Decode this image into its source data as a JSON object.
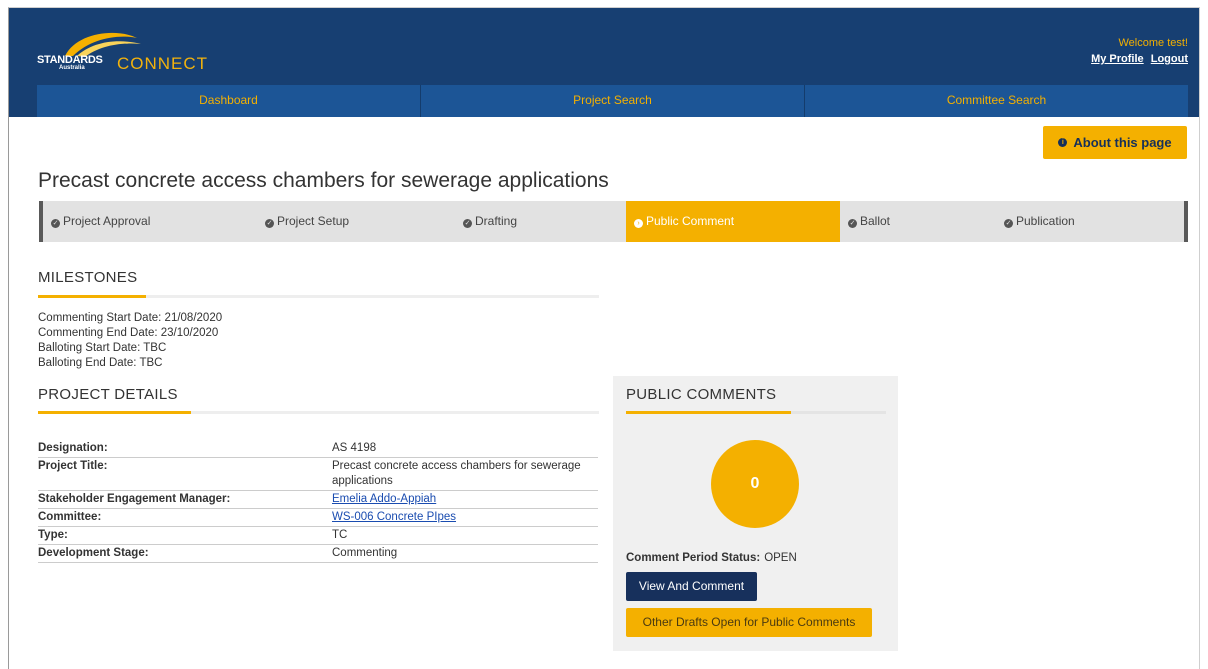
{
  "header": {
    "logo_text_standards": "STANDARDS",
    "logo_text_australia": "Australia",
    "logo_text_connect": "CONNECT",
    "welcome": "Welcome test!",
    "my_profile": "My Profile",
    "logout": "Logout"
  },
  "nav": {
    "items": [
      {
        "label": "Dashboard"
      },
      {
        "label": "Project Search"
      },
      {
        "label": "Committee Search"
      }
    ]
  },
  "about_button": {
    "label": "About this page",
    "icon": "info-icon"
  },
  "page_title": "Precast concrete access chambers for sewerage applications",
  "stages": [
    {
      "label": "Project Approval",
      "icon": "check-circle-icon",
      "status": "complete"
    },
    {
      "label": "Project Setup",
      "icon": "check-circle-icon",
      "status": "complete"
    },
    {
      "label": "Drafting",
      "icon": "check-circle-icon",
      "status": "complete"
    },
    {
      "label": "Public Comment",
      "icon": "arrow-circle-icon",
      "status": "current"
    },
    {
      "label": "Ballot",
      "icon": "check-circle-icon",
      "status": "pending"
    },
    {
      "label": "Publication",
      "icon": "check-circle-icon",
      "status": "pending"
    }
  ],
  "milestones": {
    "title": "MILESTONES",
    "items": [
      "Commenting Start Date: 21/08/2020",
      "Commenting End Date: 23/10/2020",
      "Balloting Start Date: TBC",
      "Balloting End Date: TBC"
    ]
  },
  "project_details": {
    "title": "PROJECT DETAILS",
    "rows": [
      {
        "label": "Designation",
        "value": "AS 4198"
      },
      {
        "label": "Project Title",
        "value": "Precast concrete access chambers for sewerage applications"
      },
      {
        "label": "Stakeholder Engagement Manager",
        "value": "Emelia Addo-Appiah"
      },
      {
        "label": "Committee",
        "value": "WS-006 Concrete PIpes"
      },
      {
        "label": "Type",
        "value": "TC"
      },
      {
        "label": "Development Stage",
        "value": "Commenting"
      }
    ]
  },
  "public_comments": {
    "title": "PUBLIC COMMENTS",
    "count": "0",
    "status_label": "Comment Period Status:",
    "status_value": "OPEN",
    "view_button": "View And Comment",
    "other_button": "Other Drafts Open for Public Comments"
  },
  "colors": {
    "header_bg": "#173f72",
    "nav_bg": "#1c5596",
    "accent": "#f4b000",
    "dark_button": "#17305c"
  }
}
